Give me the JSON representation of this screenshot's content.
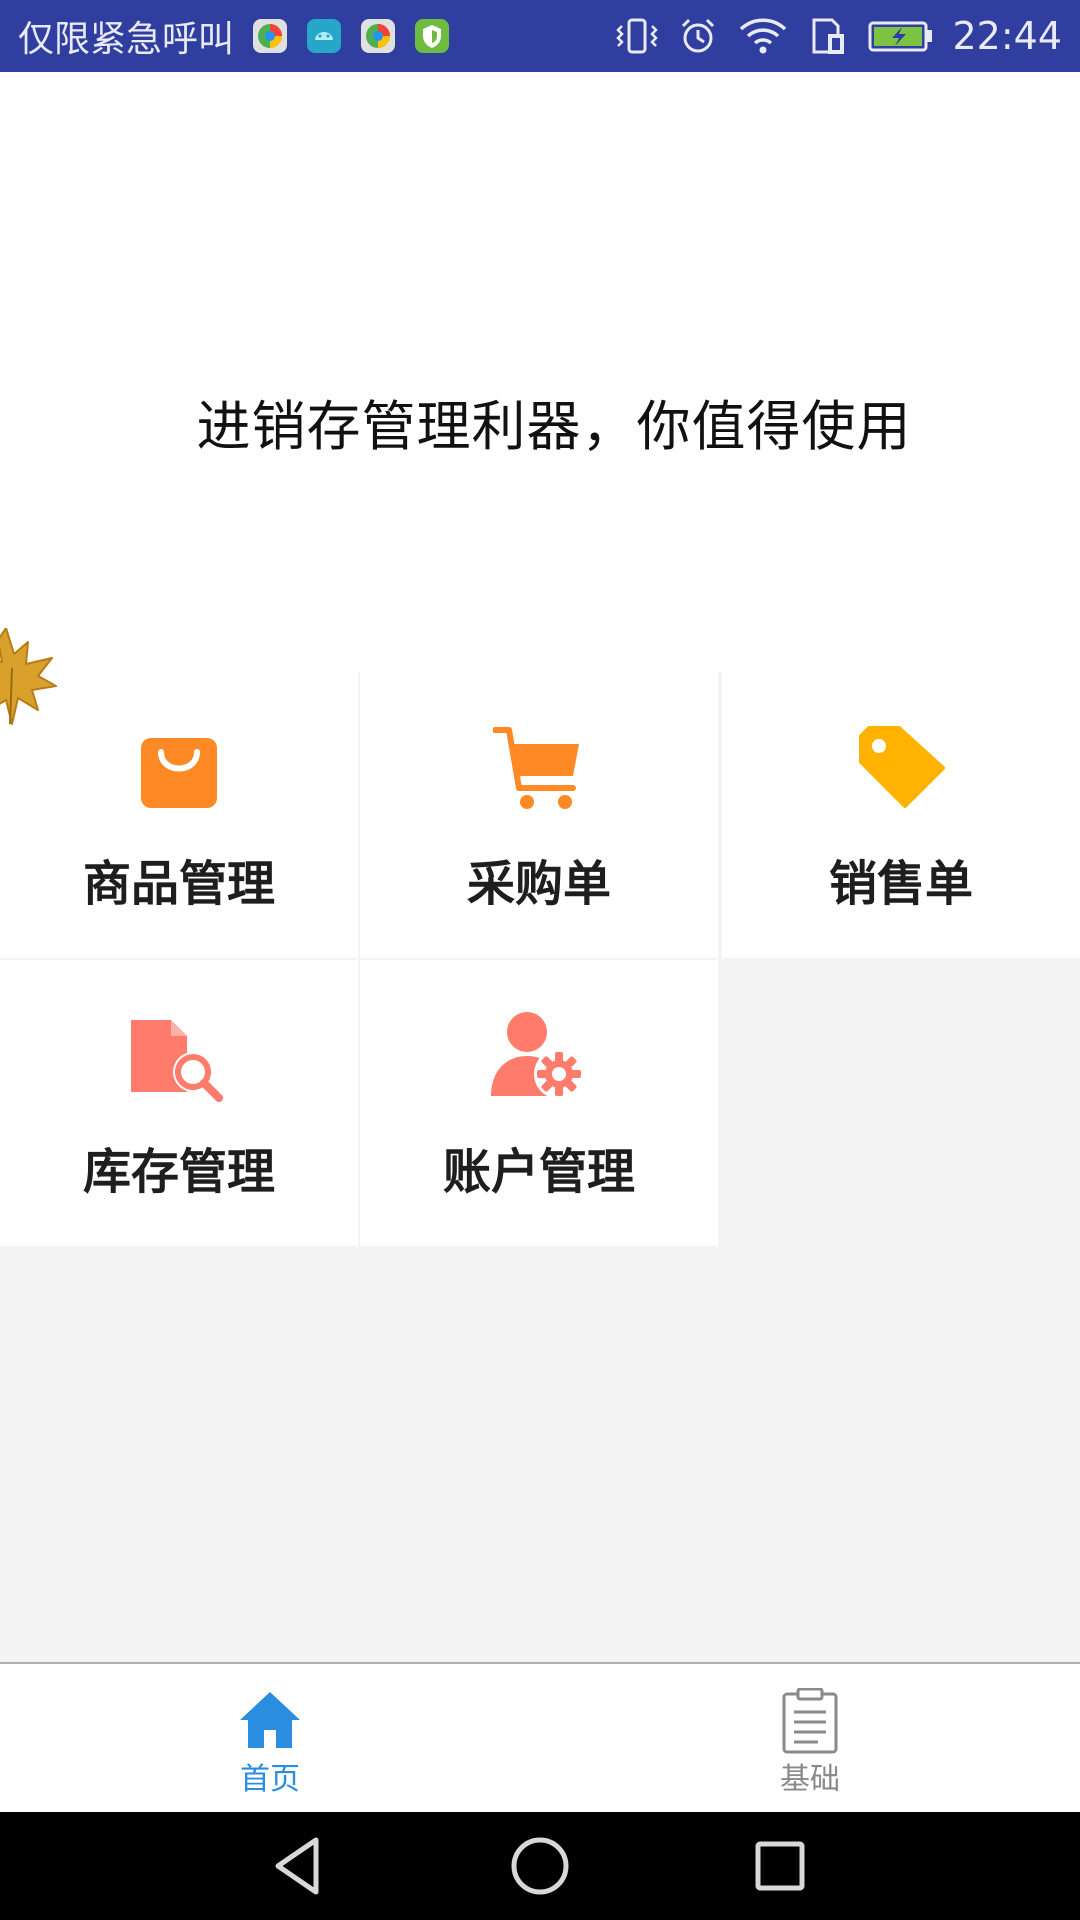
{
  "status_bar": {
    "carrier_text": "仅限紧急呼叫",
    "time": "22:44",
    "notification_icons": [
      "browser-icon",
      "android-icon",
      "browser-icon",
      "shield-icon"
    ],
    "system_icons": [
      "vibrate-icon",
      "alarm-icon",
      "wifi-icon",
      "sim-icon",
      "battery-charging-icon"
    ],
    "background_color": "#303f9f"
  },
  "banner": {
    "slogan": "进销存管理利器，你值得使用"
  },
  "grid": {
    "items": [
      {
        "label": "商品管理",
        "icon": "shopping-bag-icon",
        "color": "#ff8a25"
      },
      {
        "label": "采购单",
        "icon": "shopping-cart-icon",
        "color": "#ff8a25"
      },
      {
        "label": "销售单",
        "icon": "price-tag-icon",
        "color": "#ffb300"
      },
      {
        "label": "库存管理",
        "icon": "document-search-icon",
        "color": "#ff7b6b"
      },
      {
        "label": "账户管理",
        "icon": "user-settings-icon",
        "color": "#ff7b6b"
      }
    ]
  },
  "bottom_nav": {
    "items": [
      {
        "label": "首页",
        "icon": "home-icon",
        "active": true,
        "color": "#2a8de0"
      },
      {
        "label": "基础",
        "icon": "clipboard-icon",
        "active": false,
        "color": "#8a8a8a"
      }
    ]
  },
  "system_nav": {
    "buttons": [
      "back-icon",
      "home-circle-icon",
      "recents-icon"
    ]
  }
}
